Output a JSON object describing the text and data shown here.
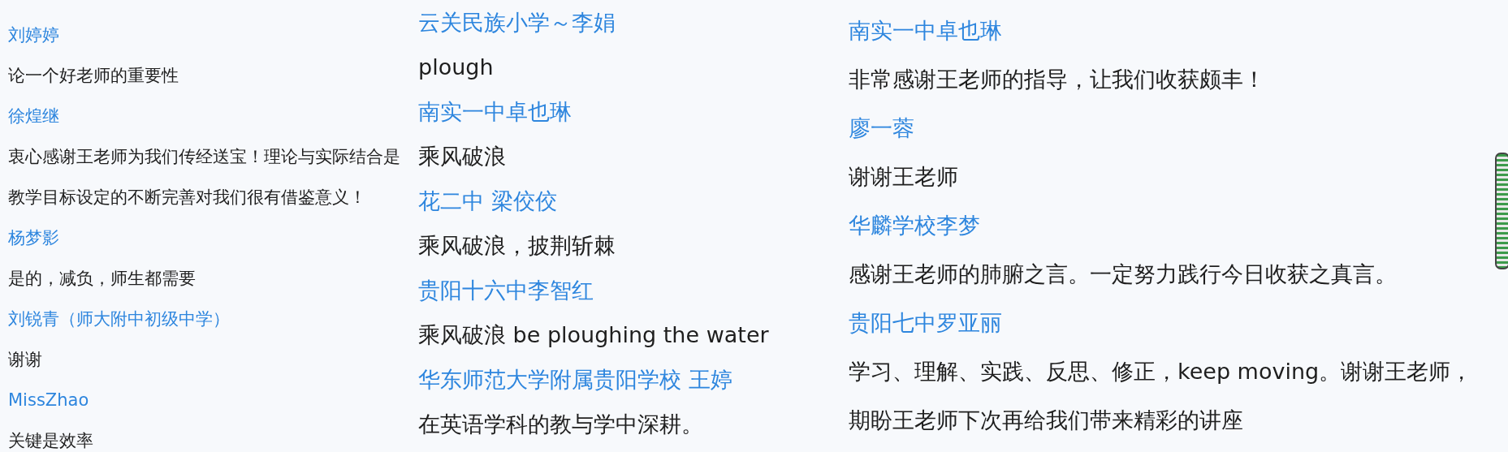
{
  "columns": [
    {
      "comments": [
        {
          "author": "刘婷婷",
          "message": "论一个好老师的重要性"
        },
        {
          "author": "徐煌继",
          "message": "衷心感谢王老师为我们传经送宝！理论与实际结合是教学目标设定的不断完善对我们很有借鉴意义！"
        },
        {
          "author": "杨梦影",
          "message": "是的，减负，师生都需要"
        },
        {
          "author": "刘锐青（师大附中初级中学）",
          "message": "谢谢"
        },
        {
          "author": "MissZhao",
          "message": "关键是效率"
        }
      ]
    },
    {
      "comments": [
        {
          "author": "云关民族小学～李娟",
          "message": "plough"
        },
        {
          "author": "南实一中卓也琳",
          "message": "乘风破浪"
        },
        {
          "author": "花二中 梁佼佼",
          "message": "乘风破浪，披荆斩棘"
        },
        {
          "author": "贵阳十六中李智红",
          "message": "乘风破浪 be ploughing the water"
        },
        {
          "author": "华东师范大学附属贵阳学校 王婷",
          "message": "在英语学科的教与学中深耕。"
        }
      ]
    },
    {
      "comments": [
        {
          "author": "南实一中卓也琳",
          "message": "非常感谢王老师的指导，让我们收获颇丰！"
        },
        {
          "author": "廖一蓉",
          "message": "谢谢王老师"
        },
        {
          "author": "华麟学校李梦",
          "message": "感谢王老师的肺腑之言。一定努力践行今日收获之真言。"
        },
        {
          "author": "贵阳七中罗亚丽",
          "message": "学习、理解、实践、反思、修正，keep moving。谢谢王老师，期盼王老师下次再给我们带来精彩的讲座"
        }
      ]
    }
  ]
}
